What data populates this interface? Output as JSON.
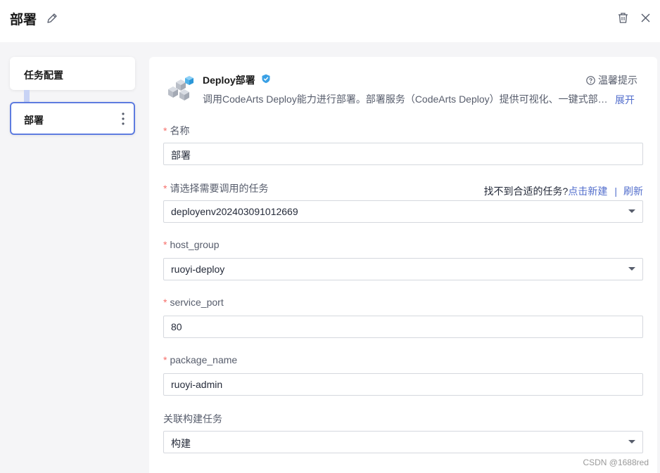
{
  "header": {
    "title": "部署"
  },
  "stages": [
    {
      "label": "任务配置"
    },
    {
      "label": "部署"
    }
  ],
  "plugin": {
    "title": "Deploy部署",
    "description": "调用CodeArts Deploy能力进行部署。部署服务（CodeArts Deploy）提供可视化、一键式部署服务",
    "tip_label": "温馨提示",
    "expand_label": "展开"
  },
  "form": {
    "name": {
      "label": "名称",
      "value": "部署"
    },
    "task": {
      "label": "请选择需要调用的任务",
      "value": "deployenv202403091012669"
    },
    "task_hint": {
      "text": "找不到合适的任务?",
      "create": "点击新建",
      "separator": "|",
      "refresh": "刷新"
    },
    "host_group": {
      "label": "host_group",
      "value": "ruoyi-deploy"
    },
    "service_port": {
      "label": "service_port",
      "value": "80"
    },
    "package_name": {
      "label": "package_name",
      "value": "ruoyi-admin"
    },
    "build_task": {
      "label": "关联构建任务",
      "value": "构建"
    }
  },
  "watermark": "CSDN @1688red",
  "colors": {
    "accent": "#5e7ce0",
    "link": "#526ecc",
    "required": "#f66f6a"
  }
}
